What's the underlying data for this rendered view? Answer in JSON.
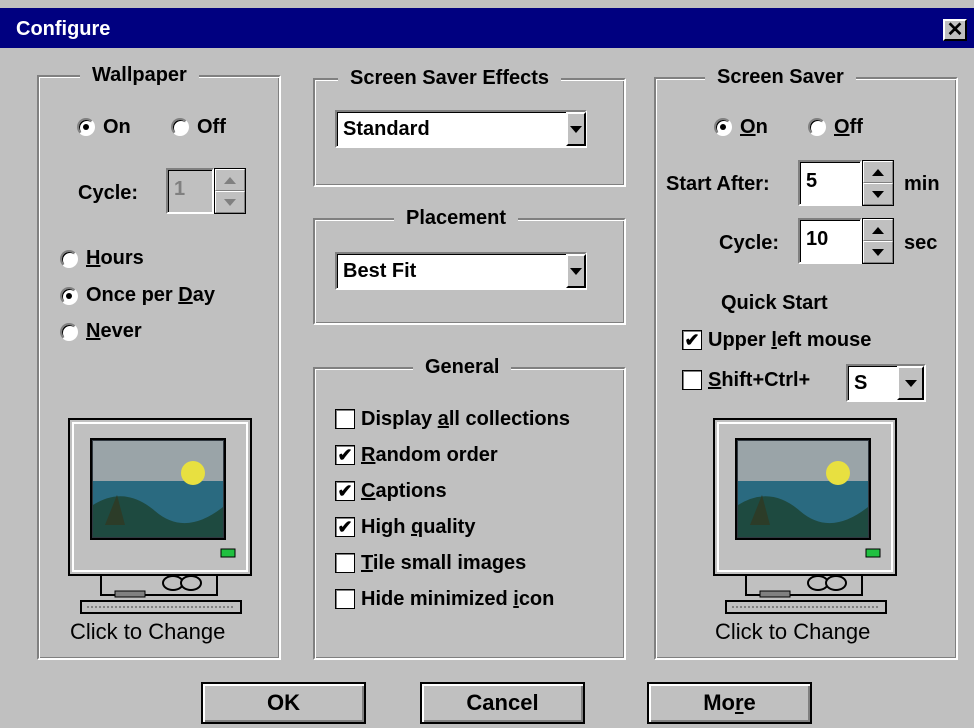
{
  "window": {
    "title": "Configure",
    "close_label": "✕"
  },
  "wallpaper": {
    "title": "Wallpaper",
    "on_label": "On",
    "off_label": "Off",
    "cycle_label": "Cycle:",
    "cycle_value": "1",
    "hours_label": "Hours",
    "once_label_a": "Once per ",
    "once_label_b": "D",
    "once_label_c": "ay",
    "never_label_a": "N",
    "never_label_b": "ever",
    "hours_u": "H",
    "hours_rest": "ours",
    "caption": "Click to Change"
  },
  "effects": {
    "title": "Screen Saver Effects",
    "selected": "Standard"
  },
  "placement": {
    "title": "Placement",
    "selected": "Best Fit"
  },
  "general": {
    "title": "General",
    "items": [
      {
        "pre": "Display ",
        "u": "a",
        "post": "ll collections",
        "checked": false
      },
      {
        "pre": "",
        "u": "R",
        "post": "andom order",
        "checked": true
      },
      {
        "pre": "",
        "u": "C",
        "post": "aptions",
        "checked": true
      },
      {
        "pre": "High ",
        "u": "q",
        "post": "uality",
        "checked": true
      },
      {
        "pre": "",
        "u": "T",
        "post": "ile small images",
        "checked": false
      },
      {
        "pre": "Hide minimized ",
        "u": "i",
        "post": "con",
        "checked": false
      }
    ]
  },
  "screensaver": {
    "title": "Screen Saver",
    "on_u": "O",
    "on_rest": "n",
    "off_u": "O",
    "off_rest": "ff",
    "start_label": "Start After:",
    "start_value": "5",
    "start_unit": "min",
    "cycle_label": "Cycle:",
    "cycle_value": "10",
    "cycle_unit": "sec",
    "quick_title": "Quick Start",
    "upper_pre": "Upper ",
    "upper_u": "l",
    "upper_post": "eft mouse",
    "shift_u": "S",
    "shift_rest": "hift+Ctrl+",
    "key_value": "S",
    "caption": "Click to Change"
  },
  "buttons": {
    "ok": "OK",
    "cancel": "Cancel",
    "more_a": "Mo",
    "more_u": "r",
    "more_b": "e"
  },
  "colors": {
    "titlebar": "#000080",
    "face": "#c0c0c0"
  }
}
